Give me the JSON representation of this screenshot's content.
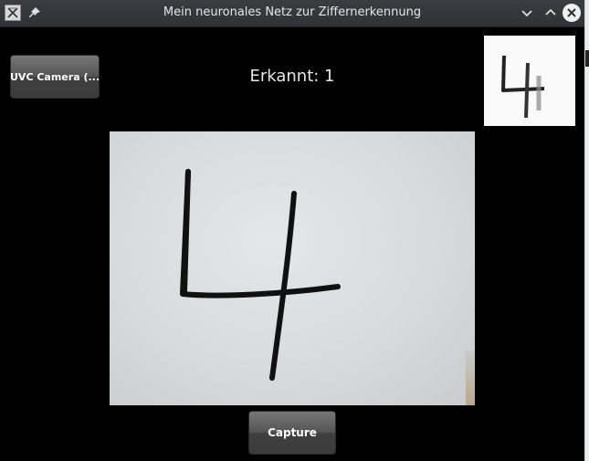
{
  "window": {
    "title": "Mein neuronales Netz zur Ziffernerkennung"
  },
  "toolbar": {
    "camera_label": "UVC Camera (...",
    "result_text": "Erkannt: 1"
  },
  "footer": {
    "capture_label": "Capture"
  },
  "icons": {
    "app": "app-icon",
    "pin": "pin-icon",
    "minimize": "chevron-down-icon",
    "maximize": "chevron-up-icon",
    "close": "close-icon"
  },
  "colors": {
    "titlebar": "#34373a",
    "background": "#000000",
    "button": "#555555"
  }
}
